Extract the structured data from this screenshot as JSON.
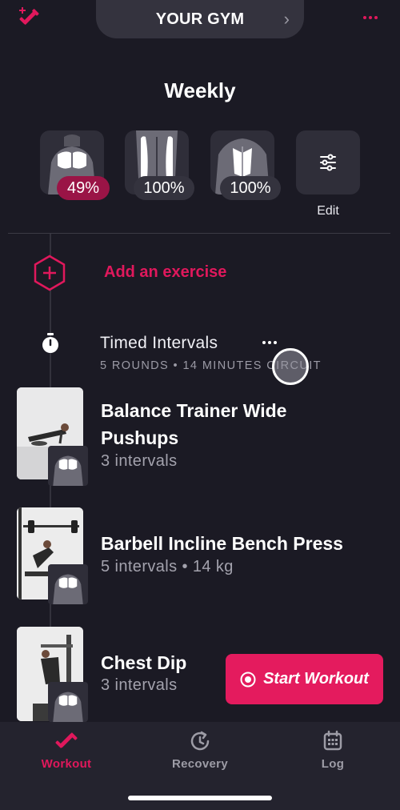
{
  "top_bar": {
    "gym_name": "YOUR GYM",
    "chevron": "›",
    "logo_icon": "dumbbell-sparkle-icon",
    "more_icon": "more-dots-icon"
  },
  "weekly": {
    "title": "Weekly",
    "tiles": [
      {
        "muscle": "chest",
        "percent": "49%"
      },
      {
        "muscle": "legs",
        "percent": "100%"
      },
      {
        "muscle": "back",
        "percent": "100%"
      }
    ],
    "edit_label": "Edit"
  },
  "add_exercise": {
    "label": "Add an exercise"
  },
  "circuit": {
    "title": "Timed Intervals",
    "subtitle": "5 ROUNDS • 14 MINUTES CIRCUIT"
  },
  "exercises": [
    {
      "name_line1": "Balance Trainer Wide",
      "name_line2": "Pushups",
      "meta": "3 intervals"
    },
    {
      "name_line1": "Barbell Incline Bench Press",
      "meta": "5 intervals • 14 kg"
    },
    {
      "name_line1": "Chest Dip",
      "meta": "3 intervals"
    }
  ],
  "start_button": {
    "label": "Start Workout"
  },
  "bottom_nav": {
    "items": [
      {
        "label": "Workout",
        "icon": "dumbbell-icon",
        "active": true
      },
      {
        "label": "Recovery",
        "icon": "recovery-clock-icon",
        "active": false
      },
      {
        "label": "Log",
        "icon": "calendar-icon",
        "active": false
      }
    ]
  },
  "colors": {
    "background": "#1b1a24",
    "accent": "#e0185c",
    "surface": "#2f2e39",
    "low_badge": "#9a1446"
  }
}
